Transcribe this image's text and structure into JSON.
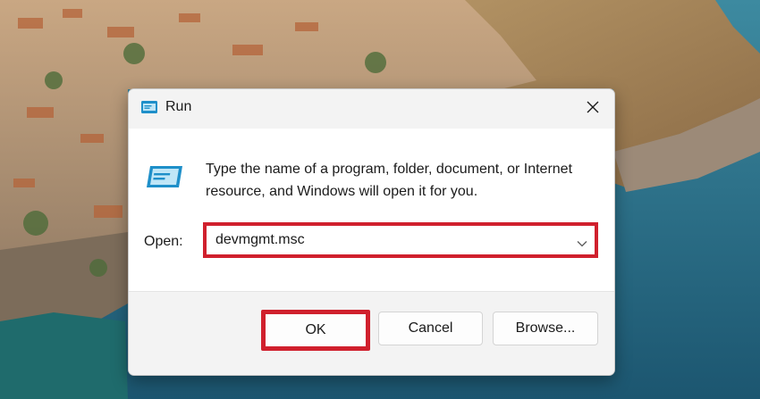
{
  "dialog": {
    "title": "Run",
    "description": "Type the name of a program, folder, document, or Internet resource, and Windows will open it for you.",
    "open_label": "Open:",
    "open_value": "devmgmt.msc",
    "buttons": {
      "ok": "OK",
      "cancel": "Cancel",
      "browse": "Browse..."
    }
  },
  "colors": {
    "highlight": "#d0202d",
    "titlebar": "#f3f3f3",
    "footer": "#f3f3f3"
  },
  "icons": {
    "title": "run-icon",
    "body": "run-icon",
    "close": "close-icon",
    "dropdown": "chevron-down-icon"
  }
}
